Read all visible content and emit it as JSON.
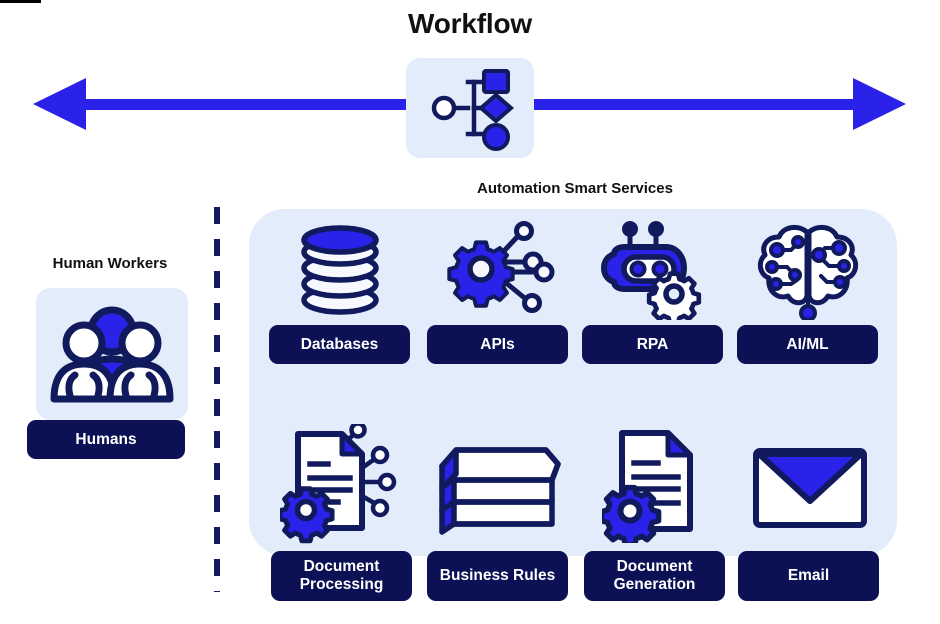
{
  "title": "Workflow",
  "colors": {
    "bright_blue": "#2a22e8",
    "navy": "#0b1154",
    "panel_blue": "#e3ecfb",
    "white": "#ffffff",
    "black": "#111111"
  },
  "arrow": {
    "name": "bidirectional-arrow",
    "direction": "both",
    "color": "#2a22e8"
  },
  "workflow_badge": {
    "icon": "workflow-flowchart-icon",
    "shapes": [
      "circle-outline",
      "square",
      "diamond",
      "circle"
    ]
  },
  "captions": {
    "automation": "Automation Smart Services",
    "human": "Human Workers"
  },
  "human_side": {
    "icon": "people-group-icon",
    "chip": "Humans"
  },
  "divider": {
    "name": "dashed-divider",
    "style": "dashed",
    "color": "#101a5c"
  },
  "services": {
    "row1": [
      {
        "id": "databases",
        "label": "Databases",
        "icon": "database-stack-icon",
        "lines": 1
      },
      {
        "id": "apis",
        "label": "APIs",
        "icon": "gear-network-icon",
        "lines": 1
      },
      {
        "id": "rpa",
        "label": "RPA",
        "icon": "robot-gear-icon",
        "lines": 1
      },
      {
        "id": "aiml",
        "label": "AI/ML",
        "icon": "brain-circuit-icon",
        "lines": 1
      }
    ],
    "row2": [
      {
        "id": "docproc",
        "label": "Document\nProcessing",
        "label_line1": "Document",
        "label_line2": "Processing",
        "icon": "document-gear-network-icon",
        "lines": 2
      },
      {
        "id": "bizrules",
        "label": "Business Rules",
        "label_line1": "Business Rules",
        "label_line2": "",
        "icon": "books-stack-icon",
        "lines": 1
      },
      {
        "id": "docgen",
        "label": "Document\nGeneration",
        "label_line1": "Document",
        "label_line2": "Generation",
        "icon": "document-gear-icon",
        "lines": 2
      },
      {
        "id": "email",
        "label": "Email",
        "label_line1": "Email",
        "label_line2": "",
        "icon": "envelope-icon",
        "lines": 1
      }
    ]
  }
}
